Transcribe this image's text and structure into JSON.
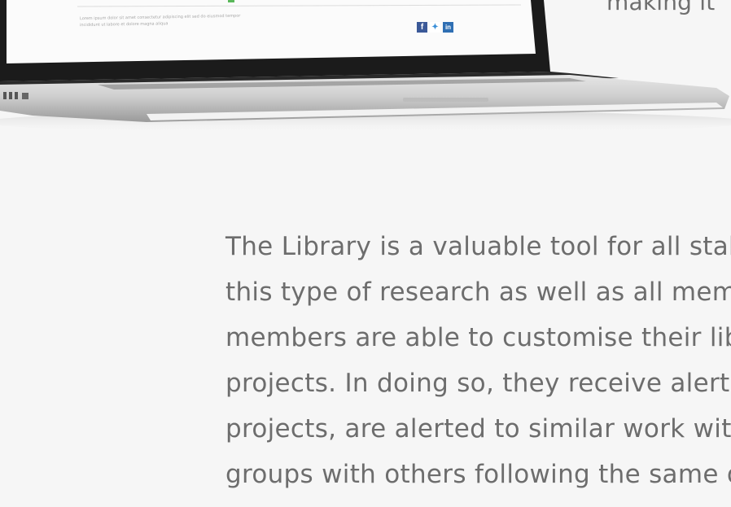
{
  "header": {
    "top_right_text": "making it"
  },
  "laptop_screen": {
    "fine_print_line_1": "Lorem ipsum dolor sit amet consectetur adipiscing elit sed do eiusmod tempor",
    "fine_print_line_2": "incididunt ut labore et dolore magna aliqua"
  },
  "share_icons": [
    "facebook-icon",
    "twitter-icon",
    "linkedin-icon"
  ],
  "colors": {
    "facebook": "#3b5998",
    "twitter": "#3a8fd8",
    "linkedin": "#2f6fb3",
    "text": "#6d6d6d",
    "background": "#f6f6f6"
  },
  "body": {
    "lines": [
      "The Library is a valuable tool for all stak",
      "this type of research as well as all meml",
      "members are able to customise their lib",
      "projects. In doing so, they receive alerts",
      "projects, are alerted to similar work wit",
      "groups with others following the same o"
    ]
  }
}
